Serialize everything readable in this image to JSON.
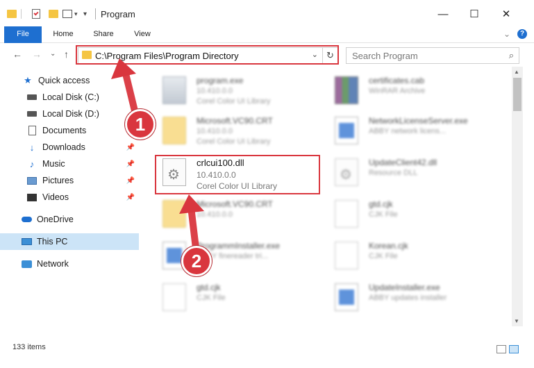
{
  "window": {
    "title": "Program",
    "minimize": "—",
    "maximize": "☐",
    "close": "✕"
  },
  "ribbon": {
    "tabs": [
      "File",
      "Home",
      "Share",
      "View"
    ],
    "collapse": "⌄",
    "help": "?"
  },
  "nav": {
    "back": "←",
    "forward": "→",
    "recent": "⌄",
    "up": "↑",
    "address": "C:\\Program Files\\Program Directory",
    "address_dropdown": "⌄",
    "refresh": "↻",
    "search_placeholder": "Search Program",
    "search_icon": "⌕"
  },
  "sidebar": {
    "items": [
      {
        "label": "Quick access",
        "icon": "star-icon",
        "pinned": false
      },
      {
        "label": "Local Disk (C:)",
        "icon": "drive-icon",
        "pinned": false
      },
      {
        "label": "Local Disk (D:)",
        "icon": "drive-icon",
        "pinned": false
      },
      {
        "label": "Documents",
        "icon": "documents-icon",
        "pinned": false
      },
      {
        "label": "Downloads",
        "icon": "downloads-icon",
        "pinned": true
      },
      {
        "label": "Music",
        "icon": "music-icon",
        "pinned": true
      },
      {
        "label": "Pictures",
        "icon": "pictures-icon",
        "pinned": true
      },
      {
        "label": "Videos",
        "icon": "videos-icon",
        "pinned": true
      },
      {
        "label": "OneDrive",
        "icon": "onedrive-icon",
        "pinned": false
      },
      {
        "label": "This PC",
        "icon": "this-pc-icon",
        "pinned": false,
        "selected": true
      },
      {
        "label": "Network",
        "icon": "network-icon",
        "pinned": false
      }
    ],
    "pin_glyph": "📌"
  },
  "files": [
    {
      "name": "program.exe",
      "version": "10.410.0.0",
      "desc": "Corel Color UI Library",
      "icon": "exe",
      "blurred": true
    },
    {
      "name": "certificates.cab",
      "version": "",
      "desc": "WinRAR Archive",
      "icon": "cab",
      "blurred": true
    },
    {
      "name": "Microsoft.VC90.CRT",
      "version": "10.410.0.0",
      "desc": "Corel Color UI Library",
      "icon": "folder",
      "blurred": true
    },
    {
      "name": "NetworkLicenseServer.exe",
      "version": "",
      "desc": "ABBY network licens...",
      "icon": "app",
      "blurred": true
    },
    {
      "name": "crlcui100.dll",
      "version": "10.410.0.0",
      "desc": "Corel Color UI Library",
      "icon": "dll",
      "blurred": false,
      "highlighted": true
    },
    {
      "name": "UpdateClient42.dll",
      "version": "",
      "desc": "Resource DLL",
      "icon": "dll",
      "blurred": true
    },
    {
      "name": "Microsoft.VC90.CRT",
      "version": "10.410.0.0",
      "desc": "",
      "icon": "folder",
      "blurred": true
    },
    {
      "name": "gtd.cjk",
      "version": "",
      "desc": "CJK File",
      "icon": "page",
      "blurred": true
    },
    {
      "name": "ProgrammInstaller.exe",
      "version": "",
      "desc": "ABBY finereader tri...",
      "icon": "app",
      "blurred": true
    },
    {
      "name": "Korean.cjk",
      "version": "",
      "desc": "CJK File",
      "icon": "page",
      "blurred": true
    },
    {
      "name": "gtd.cjk",
      "version": "",
      "desc": "CJK File",
      "icon": "page",
      "blurred": true
    },
    {
      "name": "UpdateInstaller.exe",
      "version": "",
      "desc": "ABBY updates installer",
      "icon": "app",
      "blurred": true
    }
  ],
  "status": {
    "items_count": "133 items"
  },
  "annotations": {
    "step1": "1",
    "step2": "2",
    "accent": "#d9363e"
  }
}
